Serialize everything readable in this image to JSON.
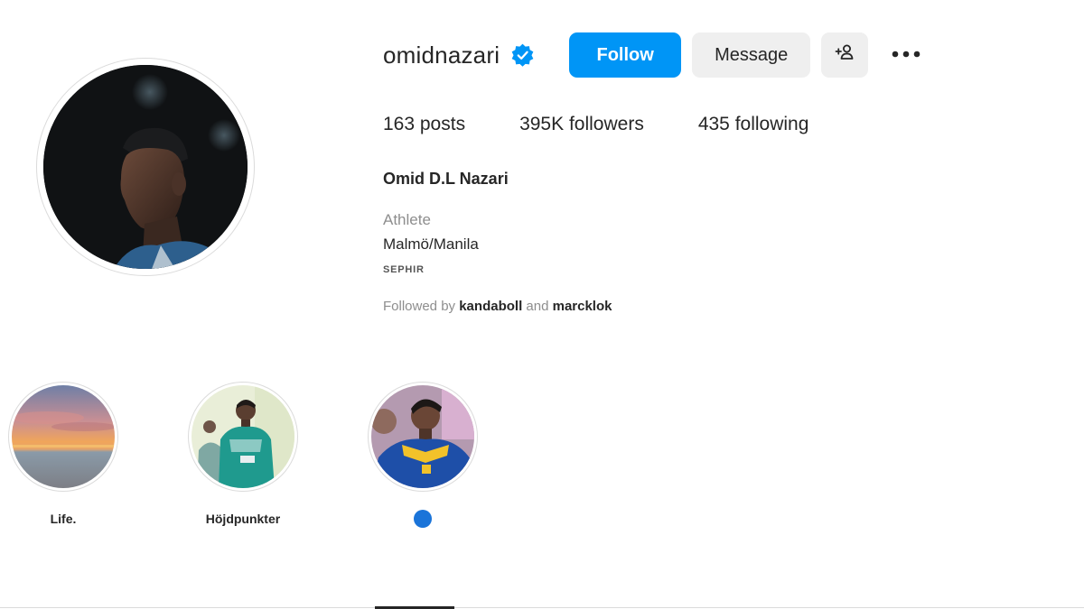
{
  "profile": {
    "username": "omidnazari",
    "verified": true,
    "follow_label": "Follow",
    "message_label": "Message",
    "stats": {
      "posts": "163 posts",
      "followers": "395K followers",
      "following": "435 following"
    },
    "full_name": "Omid D.L Nazari",
    "category": "Athlete",
    "location": "Malmö/Manila",
    "brand": "SEPHIR",
    "followed_by": {
      "prefix": "Followed by",
      "accounts": [
        "kandaboll",
        "marcklok"
      ],
      "conjunction": "and"
    }
  },
  "highlights": [
    {
      "label": "Life."
    },
    {
      "label": "Höjdpunkter"
    },
    {
      "label": "",
      "has_dot": true
    }
  ],
  "colors": {
    "accent": "#0095f6",
    "verified_badge": "#0095f6",
    "secondary_button": "#efefef",
    "text_primary": "#262626",
    "text_secondary": "#8e8e8e",
    "highlight_dot": "#1a74d9"
  },
  "icons": {
    "verified": "verified-badge-icon",
    "suggest": "add-person-icon",
    "more": "more-options-icon"
  }
}
